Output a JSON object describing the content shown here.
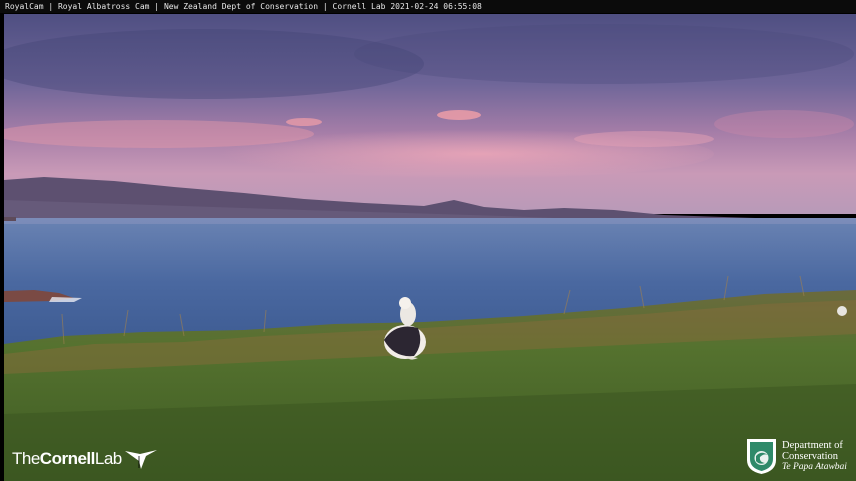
{
  "caption": {
    "text": "RoyalCam | Royal Albatross Cam | New Zealand Dept of Conservation | Cornell Lab 2021-02-24 06:55:08"
  },
  "scene": {
    "subject": "albatross-icon",
    "colors": {
      "sky_top": "#5b5d8c",
      "sky_pink": "#d58aa7",
      "hills": "#5a4d6b",
      "water": "#4a6b9e",
      "grass": "#4f6a2e",
      "grass_dry": "#8a6a3e"
    }
  },
  "logos": {
    "cornell": {
      "prefix": "The",
      "bold": "Cornell",
      "suffix": "Lab"
    },
    "doc": {
      "line1": "Department of",
      "line2": "Conservation",
      "line3": "Te Papa Atawbai"
    }
  }
}
